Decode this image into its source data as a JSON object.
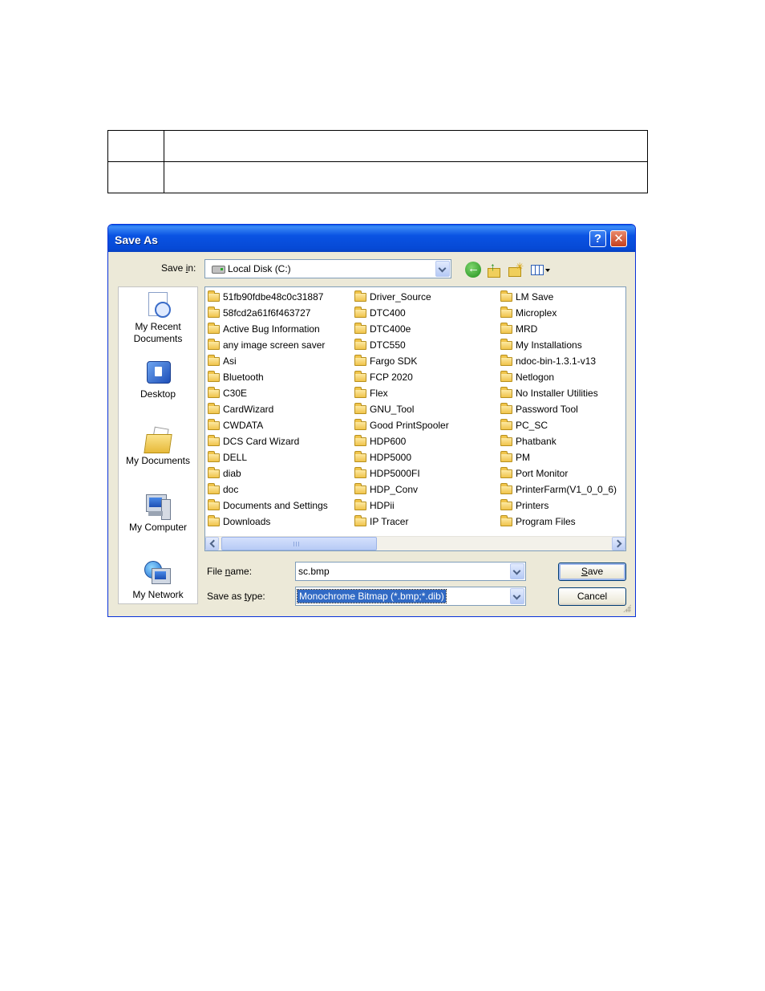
{
  "dialog": {
    "title": "Save As",
    "help_button": "?",
    "close_button": "✕"
  },
  "save_in": {
    "label_prefix": "Save ",
    "label_accel": "i",
    "label_suffix": "n:",
    "value": "Local Disk (C:)"
  },
  "toolbar": {
    "back_icon": "back-icon",
    "up_icon": "up-folder-icon",
    "new_folder_icon": "new-folder-icon",
    "views_icon": "views-menu-icon"
  },
  "places": [
    {
      "line1": "My Recent",
      "line2": "Documents",
      "icon": "recent-documents-icon"
    },
    {
      "line1": "Desktop",
      "line2": "",
      "icon": "desktop-icon"
    },
    {
      "line1": "My Documents",
      "line2": "",
      "icon": "my-documents-icon"
    },
    {
      "line1": "My Computer",
      "line2": "",
      "icon": "my-computer-icon"
    },
    {
      "line1": "My Network",
      "line2": "",
      "icon": "my-network-icon"
    }
  ],
  "files": {
    "col1": [
      "51fb90fdbe48c0c31887",
      "58fcd2a61f6f463727",
      "Active Bug Information",
      "any image screen saver",
      "Asi",
      "Bluetooth",
      "C30E",
      "CardWizard",
      "CWDATA",
      "DCS Card Wizard",
      "DELL",
      "diab",
      "doc",
      "Documents and Settings",
      "Downloads"
    ],
    "col2": [
      "Driver_Source",
      "DTC400",
      "DTC400e",
      "DTC550",
      "Fargo SDK",
      "FCP 2020",
      "Flex",
      "GNU_Tool",
      "Good PrintSpooler",
      "HDP600",
      "HDP5000",
      "HDP5000FI",
      "HDP_Conv",
      "HDPii",
      "IP Tracer"
    ],
    "col3": [
      "LM Save",
      "Microplex",
      "MRD",
      "My Installations",
      "ndoc-bin-1.3.1-v13",
      "Netlogon",
      "No Installer Utilities",
      "Password Tool",
      "PC_SC",
      "Phatbank",
      "PM",
      "Port Monitor",
      "PrinterFarm(V1_0_0_6)",
      "Printers",
      "Program Files"
    ]
  },
  "file_name": {
    "label_prefix": "File ",
    "label_accel": "n",
    "label_suffix": "ame:",
    "value": "sc.bmp"
  },
  "save_as_type": {
    "label_prefix": "Save as ",
    "label_accel": "t",
    "label_suffix": "ype:",
    "value": "Monochrome Bitmap (*.bmp;*.dib)"
  },
  "buttons": {
    "save_accel": "S",
    "save_rest": "ave",
    "cancel": "Cancel"
  },
  "colors": {
    "titlebar": "#0A53E3",
    "dialog_face": "#ECE9D8",
    "selection": "#316AC5"
  }
}
